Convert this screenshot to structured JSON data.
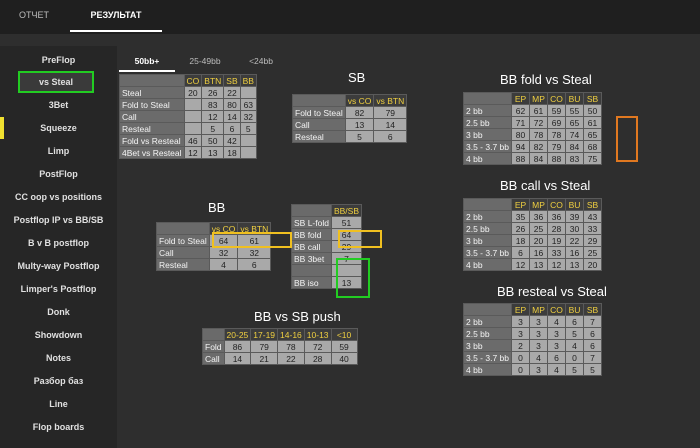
{
  "top_tabs": [
    "ОТЧЕТ",
    "РЕЗУЛЬТАТ"
  ],
  "sidebar": [
    "PreFlop",
    "vs Steal",
    "3Bet",
    "Squeeze",
    "Limp",
    "PostFlop",
    "CC oop vs positions",
    "Postflop IP vs BB/SB",
    "B v B postflop",
    "Multy-way Postflop",
    "Limper's Postflop",
    "Donk",
    "Showdown",
    "Notes",
    "Разбор баз",
    "Line",
    "Flop boards"
  ],
  "stack_tabs": [
    "50bb+",
    "25-49bb",
    "<24bb"
  ],
  "colors": {
    "highlight_yellow": "#f0c020",
    "highlight_green": "#22cc22",
    "highlight_orange": "#e07820",
    "active_item_border": "#22cc22"
  },
  "steal_table": {
    "headers": [
      "",
      "CO",
      "BTN",
      "SB",
      "BB"
    ],
    "rows": [
      {
        "label": "Steal",
        "values": [
          "20",
          "26",
          "22",
          ""
        ]
      },
      {
        "label": "Fold to Steal",
        "values": [
          "",
          "83",
          "80",
          "63"
        ]
      },
      {
        "label": "Call",
        "values": [
          "",
          "12",
          "14",
          "32"
        ]
      },
      {
        "label": "Resteal",
        "values": [
          "",
          "5",
          "6",
          "5"
        ]
      },
      {
        "label": "Fold vs Resteal",
        "values": [
          "46",
          "50",
          "42",
          ""
        ]
      },
      {
        "label": "4Bet vs Resteal",
        "values": [
          "12",
          "13",
          "18",
          ""
        ]
      }
    ]
  },
  "sb_title": "SB",
  "sb_table": {
    "headers": [
      "",
      "vs CO",
      "vs BTN"
    ],
    "rows": [
      {
        "label": "Fold to Steal",
        "values": [
          "82",
          "79"
        ]
      },
      {
        "label": "Call",
        "values": [
          "13",
          "14"
        ]
      },
      {
        "label": "Resteal",
        "values": [
          "5",
          "6"
        ]
      }
    ]
  },
  "bb_title": "BB",
  "bb_table": {
    "headers": [
      "",
      "vs CO",
      "vs BTN"
    ],
    "rows": [
      {
        "label": "Fold to Steal",
        "values": [
          "64",
          "61"
        ]
      },
      {
        "label": "Call",
        "values": [
          "32",
          "32"
        ]
      },
      {
        "label": "Resteal",
        "values": [
          "4",
          "6"
        ]
      }
    ]
  },
  "bbsb_table": {
    "headers": [
      "",
      "BB/SB"
    ],
    "rows": [
      {
        "label": "SB L-fold",
        "values": [
          "51"
        ]
      },
      {
        "label": "BB fold",
        "values": [
          "64"
        ]
      },
      {
        "label": "BB call",
        "values": [
          "29"
        ]
      },
      {
        "label": "BB 3bet",
        "values": [
          "7"
        ]
      },
      {
        "label": "",
        "values": [
          ""
        ]
      },
      {
        "label": "BB iso",
        "values": [
          "13"
        ]
      }
    ]
  },
  "push_title": "BB vs SB push",
  "push_table": {
    "headers": [
      "",
      "20-25",
      "17-19",
      "14-16",
      "10-13",
      "<10"
    ],
    "rows": [
      {
        "label": "Fold",
        "values": [
          "86",
          "79",
          "78",
          "72",
          "59"
        ]
      },
      {
        "label": "Call",
        "values": [
          "14",
          "21",
          "22",
          "28",
          "40"
        ]
      }
    ]
  },
  "bb_fold_title": "BB fold vs Steal",
  "bb_fold_table": {
    "headers": [
      "",
      "EP",
      "MP",
      "CO",
      "BU",
      "SB"
    ],
    "rows": [
      {
        "label": "2 bb",
        "values": [
          "62",
          "61",
          "59",
          "55",
          "50"
        ]
      },
      {
        "label": "2.5 bb",
        "values": [
          "71",
          "72",
          "69",
          "65",
          "61"
        ]
      },
      {
        "label": "3 bb",
        "values": [
          "80",
          "78",
          "78",
          "74",
          "65"
        ]
      },
      {
        "label": "3.5 - 3.7 bb",
        "values": [
          "94",
          "82",
          "79",
          "84",
          "68"
        ]
      },
      {
        "label": "4 bb",
        "values": [
          "88",
          "84",
          "88",
          "83",
          "75"
        ]
      }
    ]
  },
  "bb_call_title": "BB call vs Steal",
  "bb_call_table": {
    "headers": [
      "",
      "EP",
      "MP",
      "CO",
      "BU",
      "SB"
    ],
    "rows": [
      {
        "label": "2 bb",
        "values": [
          "35",
          "36",
          "36",
          "39",
          "43"
        ]
      },
      {
        "label": "2.5 bb",
        "values": [
          "26",
          "25",
          "28",
          "30",
          "33"
        ]
      },
      {
        "label": "3 bb",
        "values": [
          "18",
          "20",
          "19",
          "22",
          "29"
        ]
      },
      {
        "label": "3.5 - 3.7 bb",
        "values": [
          "6",
          "16",
          "33",
          "16",
          "25"
        ]
      },
      {
        "label": "4 bb",
        "values": [
          "12",
          "13",
          "12",
          "13",
          "20"
        ]
      }
    ]
  },
  "bb_resteal_title": "BB resteal vs Steal",
  "bb_resteal_table": {
    "headers": [
      "",
      "EP",
      "MP",
      "CO",
      "BU",
      "SB"
    ],
    "rows": [
      {
        "label": "2 bb",
        "values": [
          "3",
          "3",
          "4",
          "6",
          "7"
        ]
      },
      {
        "label": "2.5 bb",
        "values": [
          "3",
          "3",
          "3",
          "5",
          "6"
        ]
      },
      {
        "label": "3 bb",
        "values": [
          "2",
          "3",
          "3",
          "4",
          "6"
        ]
      },
      {
        "label": "3.5 - 3.7 bb",
        "values": [
          "0",
          "4",
          "6",
          "0",
          "7"
        ]
      },
      {
        "label": "4 bb",
        "values": [
          "0",
          "3",
          "4",
          "5",
          "5"
        ]
      }
    ]
  }
}
